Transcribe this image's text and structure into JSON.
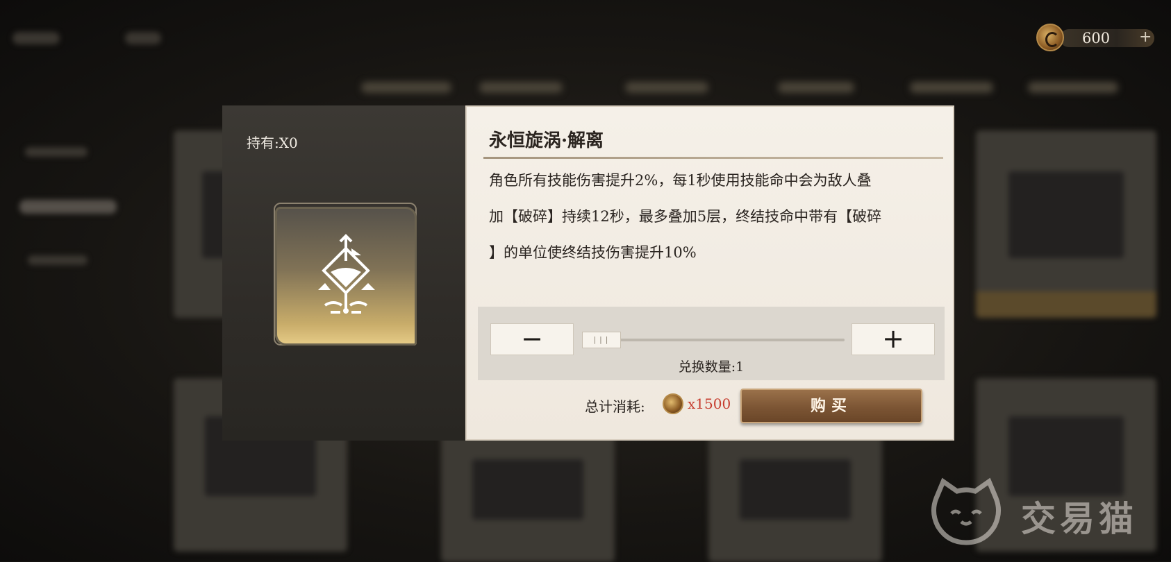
{
  "currency": {
    "icon": "gold-coin-icon",
    "amount": "600",
    "plus_label": "+"
  },
  "dialog": {
    "hold_label": "持有:X0",
    "item_icon": "rune-emblem-icon",
    "title": "永恒旋涡·解离",
    "description_lines": [
      "角色所有技能伤害提升2%，每1秒使用技能命中会为敌人叠",
      "加【破碎】持续12秒，最多叠加5层，终结技命中带有【破碎",
      "】的单位使终结技伤害提升10%"
    ],
    "quantity": {
      "minus_label": "−",
      "plus_label": "+",
      "slider_thumb": "|||",
      "slider_level": 0,
      "label": "兑换数量:1"
    },
    "total_label": "总计消耗:",
    "total_amount": "x1500",
    "buy_label": "购买"
  },
  "watermark": {
    "text": "交易猫"
  },
  "colors": {
    "accent_gold": "#c9ad6a",
    "price_red": "#c63c2e",
    "buy_brown": "#7c5534"
  }
}
